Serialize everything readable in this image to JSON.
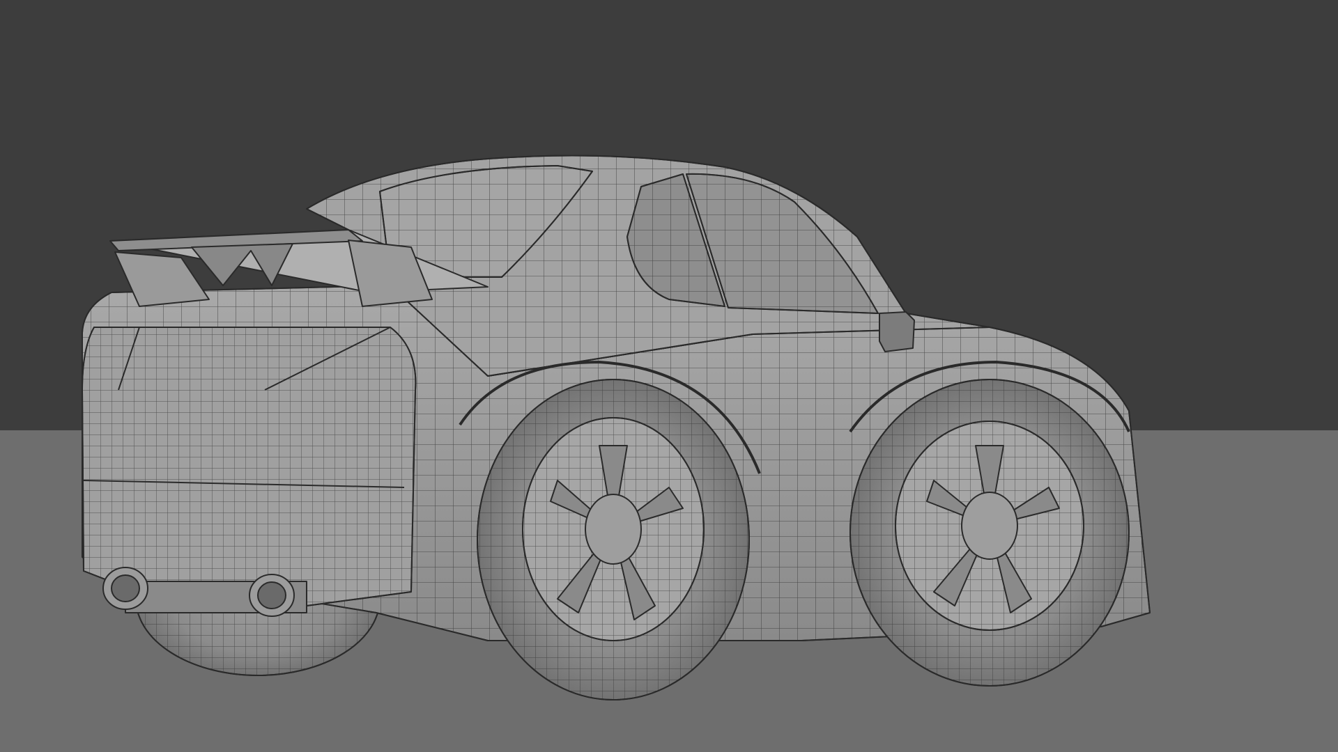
{
  "scene": {
    "subject": "car-3d-wireframe-model",
    "icon": "car-icon",
    "colors": {
      "backdrop": "#3d3d3d",
      "floor": "#6e6e6e",
      "body": "#9a9a9a",
      "body_shadow": "#7a7a7a",
      "body_light": "#b2b2b2",
      "tire": "#8f8f8f",
      "rim": "#a8a8a8",
      "edge": "#2a2a2a",
      "window": "#8a8a8a"
    }
  }
}
